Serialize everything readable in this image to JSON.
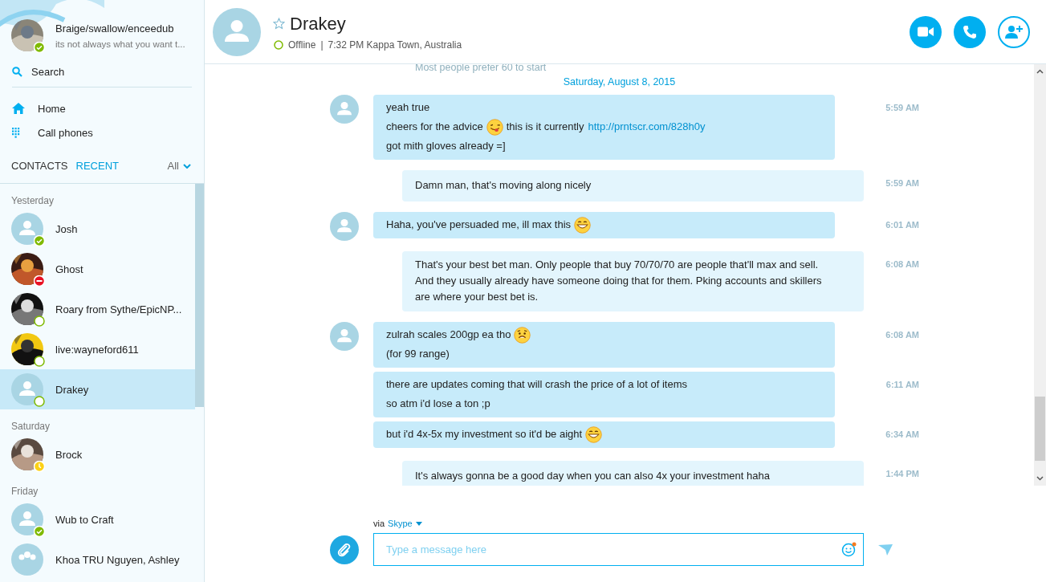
{
  "profile": {
    "name": "Braige/swallow/enceedub",
    "mood": "its not always what you want t...",
    "status": {
      "kind": "online"
    }
  },
  "search": {
    "label": "Search"
  },
  "nav": [
    {
      "label": "Home",
      "kind": "home"
    },
    {
      "label": "Call phones",
      "kind": "dialpad"
    }
  ],
  "list_tabs": [
    {
      "label": "CONTACTS",
      "selected": false
    },
    {
      "label": "RECENT",
      "selected": true
    }
  ],
  "filter": {
    "label": "All"
  },
  "recent": [
    {
      "heading": "Yesterday",
      "contacts": [
        {
          "name": "Josh",
          "avatar": {
            "kind": "default"
          },
          "status": {
            "kind": "online"
          },
          "selected": false
        },
        {
          "name": "Ghost",
          "status": {
            "kind": "busy"
          },
          "selected": false
        },
        {
          "name": "Roary from Sythe/EpicNP...",
          "status": {
            "kind": "offline"
          },
          "selected": false
        },
        {
          "name": "live:wayneford611",
          "status": {
            "kind": "offline"
          },
          "selected": false
        },
        {
          "name": "Drakey",
          "avatar": {
            "kind": "default"
          },
          "status": {
            "kind": "offline"
          },
          "selected": true
        }
      ]
    },
    {
      "heading": "Saturday",
      "contacts": [
        {
          "name": "Brock",
          "status": {
            "kind": "away"
          },
          "selected": false
        }
      ]
    },
    {
      "heading": "Friday",
      "contacts": [
        {
          "name": "Wub to Craft",
          "avatar": {
            "kind": "default"
          },
          "status": {
            "kind": "online"
          },
          "selected": false
        },
        {
          "name": "Khoa TRU Nguyen, Ashley",
          "avatar": {
            "kind": "group"
          },
          "selected": false
        }
      ]
    }
  ],
  "header": {
    "name": "Drakey",
    "favorite": false,
    "status": {
      "kind": "offline"
    },
    "status_text": "Offline",
    "separator": "|",
    "local_time": "7:32 PM Kappa Town, Australia",
    "actions": [
      {
        "kind": "video"
      },
      {
        "kind": "call"
      },
      {
        "kind": "add-contact"
      }
    ]
  },
  "chat": {
    "faded_text": "Most people prefer 60 to start",
    "date": "Saturday, August 8, 2015",
    "messages": [
      {
        "kind": "incoming",
        "time": "5:59 AM",
        "lines": [
          [
            {
              "kind": "text",
              "text": "yeah true"
            }
          ],
          [
            {
              "kind": "text",
              "text": "cheers for the advice"
            },
            {
              "kind": "tongue"
            },
            {
              "kind": "text",
              "text": "this is it currently"
            },
            {
              "kind": "link",
              "text": "http://prntscr.com/828h0y"
            }
          ],
          [
            {
              "kind": "text",
              "text": "got mith gloves already =]"
            }
          ]
        ]
      },
      {
        "kind": "outgoing",
        "time": "5:59 AM",
        "lines": [
          [
            {
              "kind": "text",
              "text": "Damn man, that's moving along nicely"
            }
          ]
        ]
      },
      {
        "kind": "incoming",
        "time": "6:01 AM",
        "lines": [
          [
            {
              "kind": "text",
              "text": "Haha, you've persuaded me, ill max this"
            },
            {
              "kind": "grin"
            }
          ]
        ]
      },
      {
        "kind": "outgoing",
        "time": "6:08 AM",
        "lines": [
          [
            {
              "kind": "text",
              "text": "That's your best bet man. Only people that buy 70/70/70 are people that'll max and sell. And they usually already have someone doing that for them. Pking accounts and skillers are where your best bet is."
            }
          ]
        ]
      },
      {
        "kind": "incoming",
        "time": "6:08 AM",
        "lines": [
          [
            {
              "kind": "text",
              "text": "zulrah scales 200gp ea tho"
            },
            {
              "kind": "worried"
            }
          ],
          [
            {
              "kind": "text",
              "text": "(for 99 range)"
            }
          ]
        ]
      },
      {
        "kind": "incoming",
        "time": "6:11 AM",
        "lines": [
          [
            {
              "kind": "text",
              "text": "there are updates coming that will crash the price of a lot of items"
            }
          ],
          [
            {
              "kind": "text",
              "text": "so atm i'd lose a ton ;p"
            }
          ]
        ]
      },
      {
        "kind": "incoming",
        "time": "6:34 AM",
        "lines": [
          [
            {
              "kind": "text",
              "text": "but i'd 4x-5x my investment so it'd be aight"
            },
            {
              "kind": "grin"
            }
          ]
        ]
      },
      {
        "kind": "outgoing",
        "time": "1:44 PM",
        "lines": [
          [
            {
              "kind": "text",
              "text": "It's always gonna be a good day when you can also 4x your investment haha"
            }
          ]
        ]
      }
    ]
  },
  "composer": {
    "via": "via",
    "service": "Skype",
    "placeholder": "Type a message here"
  }
}
